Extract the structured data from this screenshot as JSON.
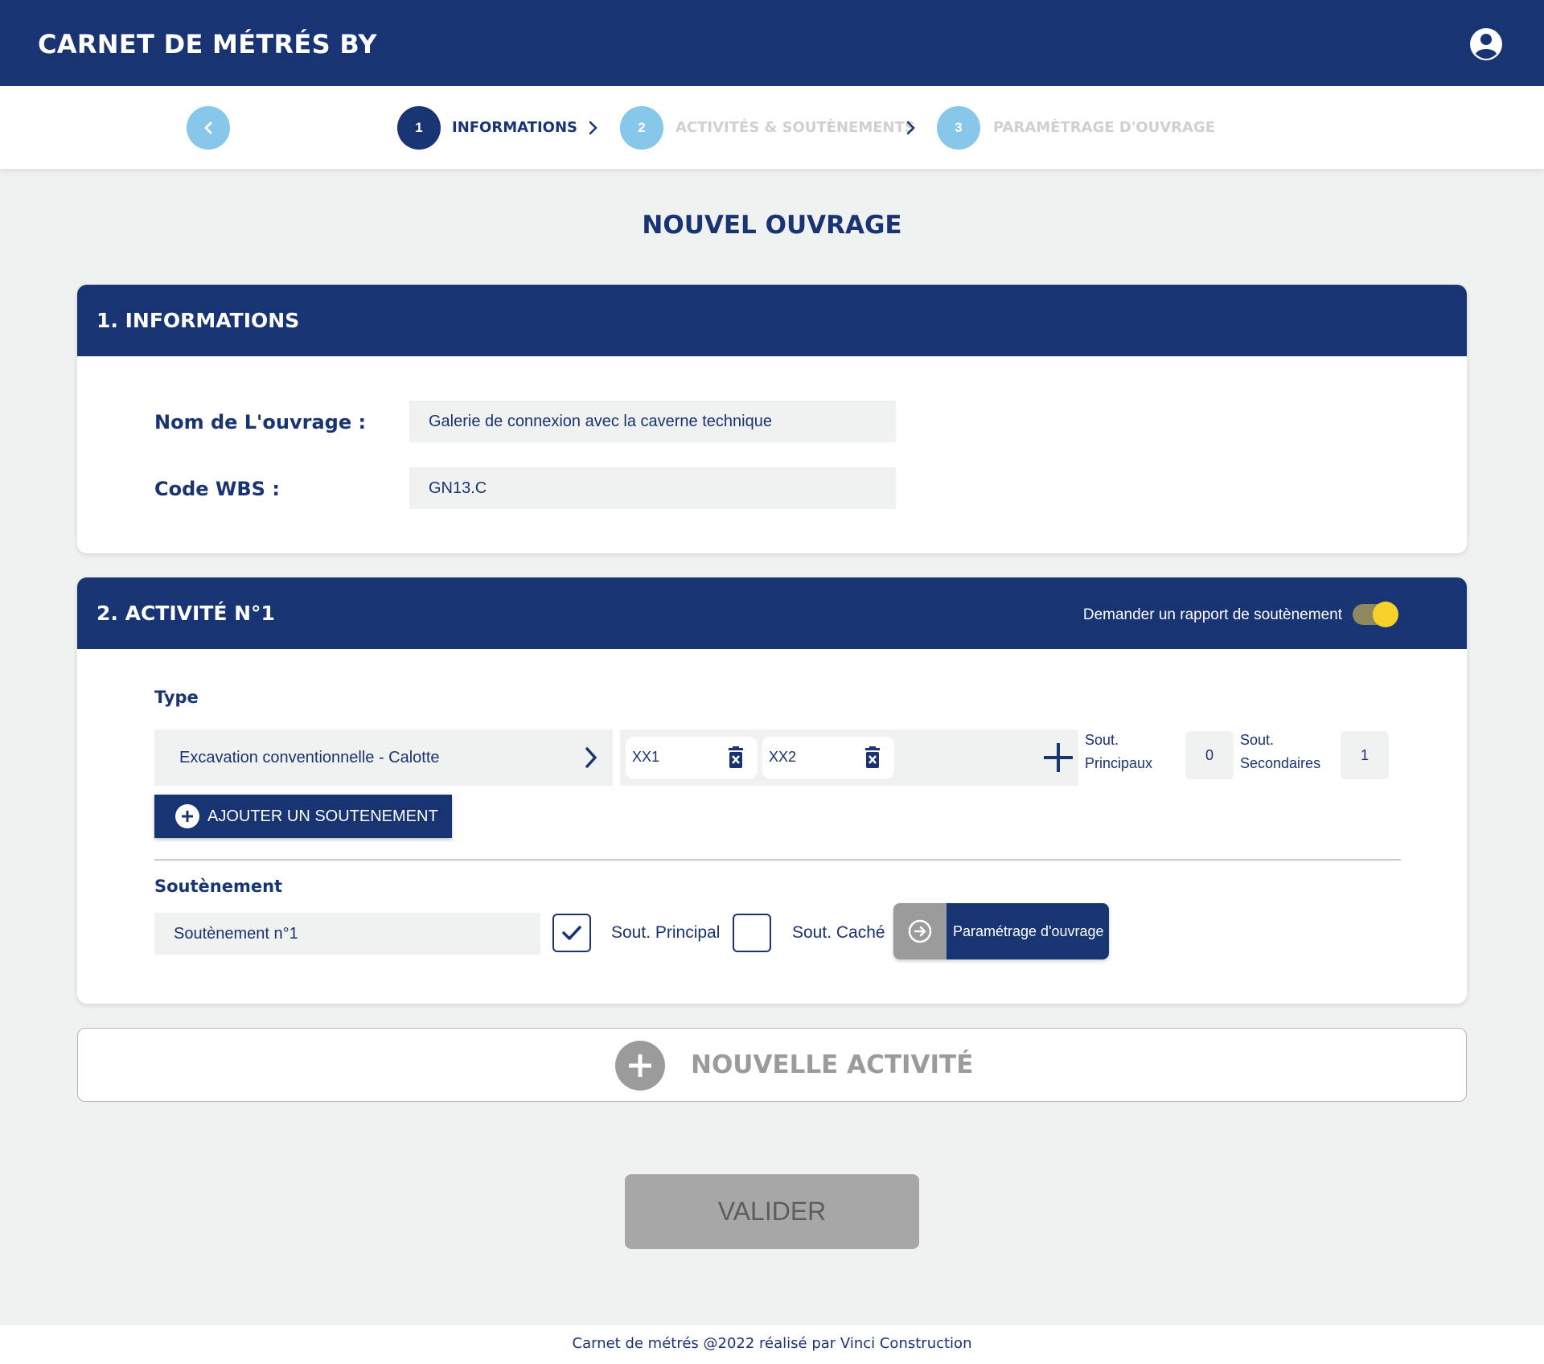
{
  "header": {
    "app_title": "CARNET DE MÉTRÉS BY",
    "account_icon": "account-circle-icon"
  },
  "stepper": {
    "back_icon": "chevron-left-icon",
    "steps": [
      {
        "number": "1",
        "label": "INFORMATIONS",
        "active": true
      },
      {
        "number": "2",
        "label": "ACTIVITÉS & SOUTÈNEMENTS",
        "active": false
      },
      {
        "number": "3",
        "label": "PARAMÈTRAGE D'OUVRAGE",
        "active": false
      }
    ]
  },
  "page": {
    "title": "NOUVEL OUVRAGE"
  },
  "informations": {
    "title": "1. INFORMATIONS",
    "nom_label": "Nom de L'ouvrage :",
    "nom_value": "Galerie de connexion avec la caverne technique",
    "wbs_label": "Code WBS :",
    "wbs_value": "GN13.C"
  },
  "activity": {
    "title": "2. ACTIVITÉ N°1",
    "toggle_label": "Demander un rapport de soutènement",
    "toggle_on": true,
    "type_label": "Type",
    "type_value": "Excavation conventionnelle - Calotte",
    "chips": [
      "XX1",
      "XX2"
    ],
    "sout_principaux_label_1": "Sout.",
    "sout_principaux_label_2": "Principaux",
    "sout_principaux_count": "0",
    "sout_secondaires_label_1": "Sout.",
    "sout_secondaires_label_2": "Secondaires",
    "sout_secondaires_count": "1",
    "add_button": "AJOUTER UN SOUTENEMENT",
    "soutenement_label": "Soutènement",
    "soutenement_value": "Soutènement n°1",
    "principal_label": "Sout. Principal",
    "principal_checked": true,
    "cache_label": "Sout. Caché",
    "cache_checked": false,
    "param_button": "Paramétrage d'ouvrage"
  },
  "new_activity": {
    "label": "NOUVELLE ACTIVITÉ"
  },
  "actions": {
    "validate": "VALIDER"
  },
  "footer": {
    "text": "Carnet de métrés @2022 réalisé par Vinci Construction"
  },
  "colors": {
    "primary": "#183473",
    "light_blue": "#86c7ea",
    "background": "#f0f1f1",
    "toggle_knob": "#f7d22a",
    "disabled_gray": "#a7a7a7"
  }
}
